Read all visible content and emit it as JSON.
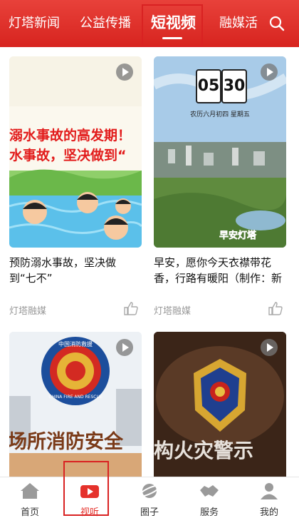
{
  "header": {
    "tabs": [
      {
        "label": "灯塔新闻"
      },
      {
        "label": "公益传播"
      },
      {
        "label": "短视频"
      },
      {
        "label": "融媒活"
      }
    ],
    "active_tab_index": 2
  },
  "feed": [
    {
      "title": "预防溺水事故，坚决做到“七不”",
      "source": "灯塔融媒",
      "thumb_text_lines": [
        "溺水事故的高发期！",
        "水事故，坚决做到“"
      ]
    },
    {
      "title": "早安，愿你今天衣襟带花香，行路有暖阳（制作：新媒体",
      "source": "灯塔融媒",
      "thumb_clock": {
        "hour": "05",
        "minute": "30"
      },
      "thumb_date": "农历六月初四 星期五",
      "thumb_badge": "早安灯塔"
    },
    {
      "title": "",
      "thumb_emblem_text": "中国消防救援",
      "thumb_emblem_en": "CHINA FIRE AND RESCUE",
      "thumb_text_lines": [
        "场所消防安全"
      ]
    },
    {
      "title": "",
      "thumb_text_lines": [
        "构火灾警示"
      ]
    }
  ],
  "bottom_nav": [
    {
      "label": "首页",
      "icon": "home-icon"
    },
    {
      "label": "视听",
      "icon": "video-icon"
    },
    {
      "label": "圈子",
      "icon": "planet-icon"
    },
    {
      "label": "服务",
      "icon": "handshake-icon"
    },
    {
      "label": "我的",
      "icon": "user-icon"
    }
  ],
  "active_nav_index": 1,
  "colors": {
    "brand_red": "#e5312b",
    "highlight": "#d92222"
  }
}
